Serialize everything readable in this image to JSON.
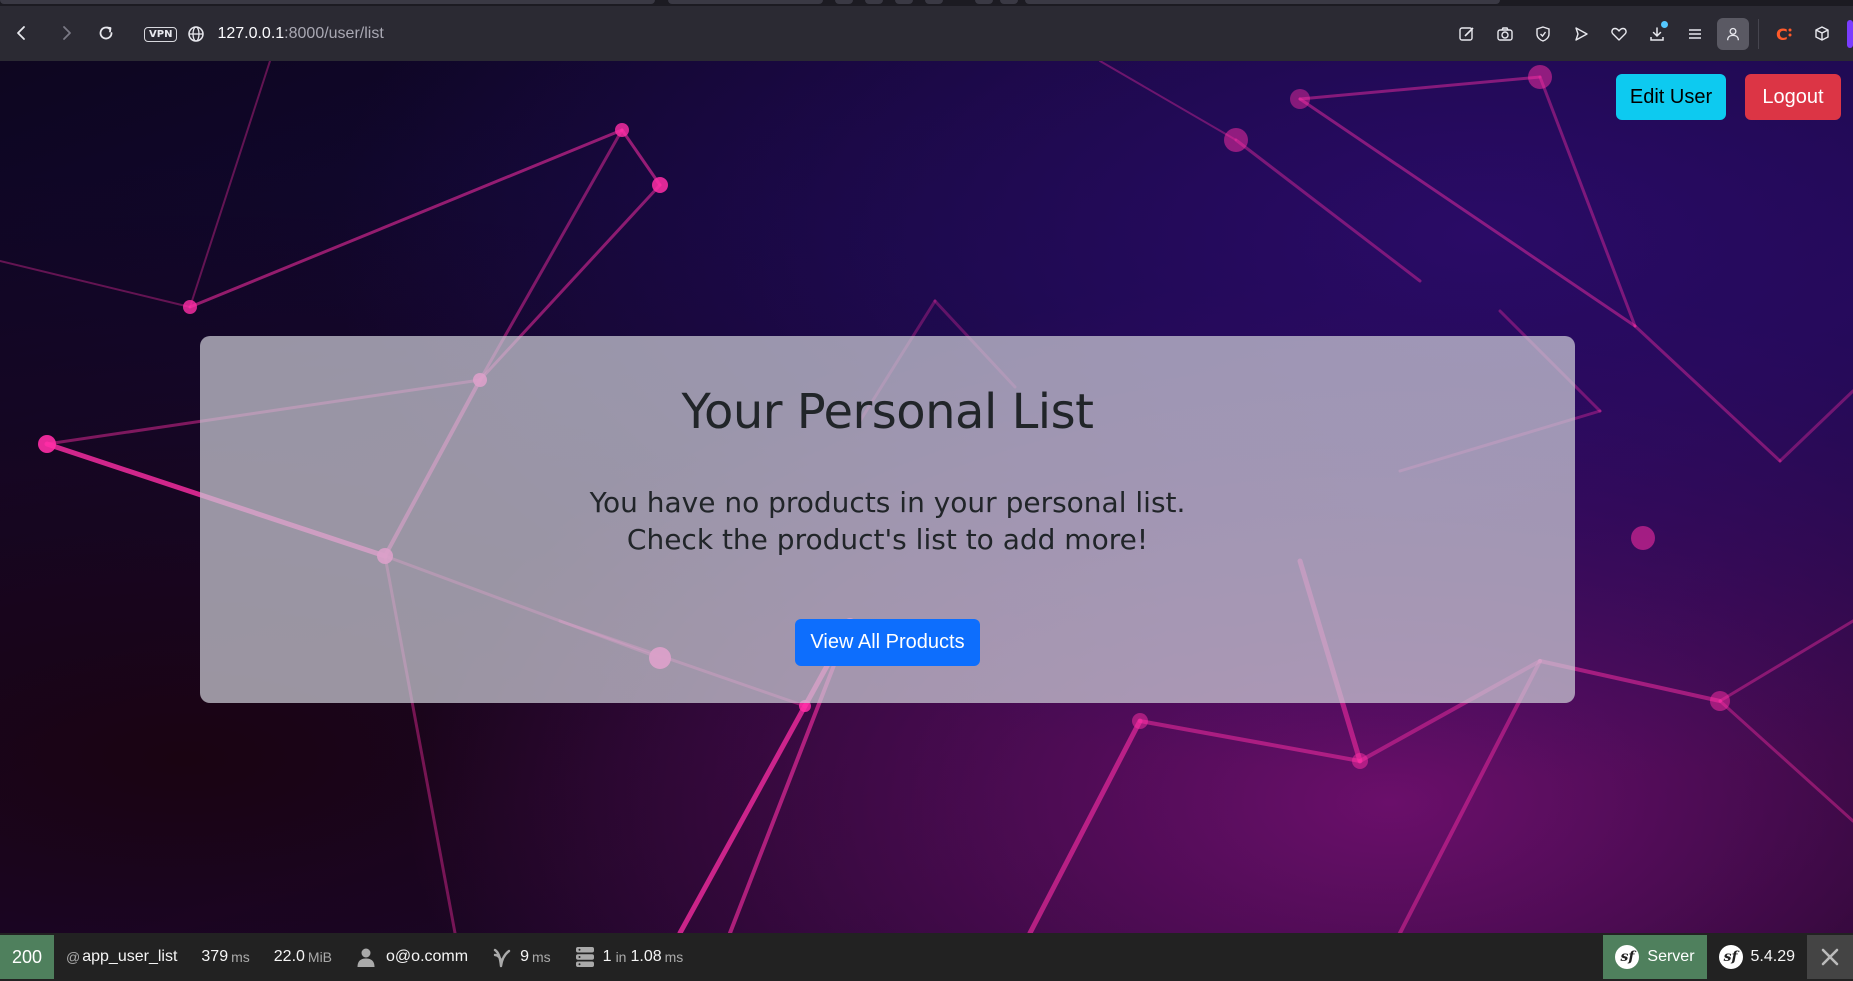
{
  "browser": {
    "url_host": "127.0.0.1",
    "url_rest": ":8000/user/list",
    "vpn_label": "VPN"
  },
  "header": {
    "edit_user_label": "Edit User",
    "logout_label": "Logout"
  },
  "main": {
    "title": "Your Personal List",
    "message_line1": "You have no products in your personal list.",
    "message_line2": "Check the product's list to add more!",
    "view_all_label": "View All Products"
  },
  "profiler": {
    "status_code": "200",
    "route_prefix": "@",
    "route": "app_user_list",
    "time_value": "379",
    "time_unit": "ms",
    "memory_value": "22.0",
    "memory_unit": "MiB",
    "user": "o@o.comm",
    "twig_value": "9",
    "twig_unit": "ms",
    "db_queries": "1",
    "db_in": "in",
    "db_time": "1.08",
    "db_unit": "ms",
    "server_label": "Server",
    "symfony_version": "5.4.29"
  },
  "colors": {
    "edit_button": "#0dcaf0",
    "logout_button": "#dc3545",
    "primary_button": "#0d6efd",
    "status_green": "#4f805d"
  },
  "icons": [
    "back-icon",
    "forward-icon",
    "reload-icon",
    "globe-icon",
    "edit-icon",
    "camera-icon",
    "shield-icon",
    "send-icon",
    "heart-icon",
    "download-icon",
    "menu-icon",
    "profile-icon",
    "extension-icon",
    "cube-icon",
    "user-icon",
    "twig-icon",
    "database-icon",
    "symfony-logo-icon",
    "close-icon"
  ]
}
